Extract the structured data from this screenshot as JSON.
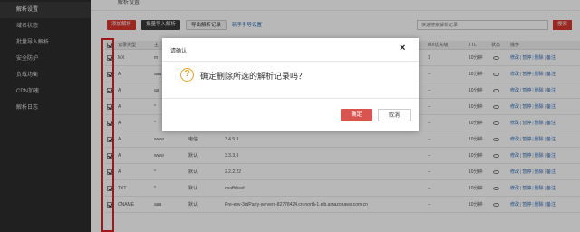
{
  "sidebar": {
    "items": [
      {
        "label": "解析设置"
      },
      {
        "label": "域名状态"
      },
      {
        "label": "批量导入解析"
      },
      {
        "label": "安全防护"
      },
      {
        "label": "负载均衡"
      },
      {
        "label": "CDN加速"
      },
      {
        "label": "解析日志"
      }
    ]
  },
  "header": {
    "breadcrumb": "解析设置"
  },
  "toolbar": {
    "add_label": "添加解析",
    "import_label": "批量导入解析",
    "export_label": "导出解析记录",
    "guide_label": "新手引导设置"
  },
  "search": {
    "placeholder": "快速搜索解析记录",
    "button_label": "搜索"
  },
  "table": {
    "columns": {
      "type": "记录类型",
      "host": "主",
      "mx": "MX优先级",
      "ttl": "TTL",
      "status": "状态",
      "ops": "操作"
    },
    "rows": [
      {
        "type": "MX",
        "host": "m",
        "line": "",
        "value": "",
        "mx": "1",
        "ttl": "10分钟"
      },
      {
        "type": "A",
        "host": "aaa",
        "line": "",
        "value": "",
        "mx": "--",
        "ttl": "10分钟"
      },
      {
        "type": "A",
        "host": "aa",
        "line": "",
        "value": "",
        "mx": "--",
        "ttl": "10分钟"
      },
      {
        "type": "A",
        "host": "*",
        "line": "",
        "value": "",
        "mx": "--",
        "ttl": "10分钟"
      },
      {
        "type": "A",
        "host": "*",
        "line": "",
        "value": "3.3.3.3",
        "mx": "--",
        "ttl": "10分钟"
      },
      {
        "type": "A",
        "host": "www",
        "line": "电信",
        "value": "3.4.5.3",
        "mx": "--",
        "ttl": "10分钟"
      },
      {
        "type": "A",
        "host": "www",
        "line": "默认",
        "value": "3.3.3.3",
        "mx": "--",
        "ttl": "10分钟"
      },
      {
        "type": "A",
        "host": "*",
        "line": "默认",
        "value": "2.2.2.22",
        "mx": "--",
        "ttl": "10分钟"
      },
      {
        "type": "TXT",
        "host": "*",
        "line": "默认",
        "value": "dsaffdsad",
        "mx": "--",
        "ttl": "10分钟"
      },
      {
        "type": "CNAME",
        "host": "aaa",
        "line": "默认",
        "value": "Pre-env-3rdParty-servers-82778424.cn-north-1.elb.amazonaws.com.cn",
        "mx": "--",
        "ttl": "10分钟"
      }
    ],
    "actions": {
      "edit": "修改",
      "pause": "暂停",
      "delete": "删除",
      "note": "备注",
      "sep": "|"
    }
  },
  "modal": {
    "title": "请确认",
    "close_icon": "×",
    "question_icon": "?",
    "message": "确定删除所选的解析记录吗？",
    "ok_label": "确定",
    "cancel_label": "取消"
  },
  "colors": {
    "accent_red": "#d9362f",
    "link_blue": "#2e6fbd",
    "highlight": "#e02020",
    "warning": "#f0a020"
  }
}
